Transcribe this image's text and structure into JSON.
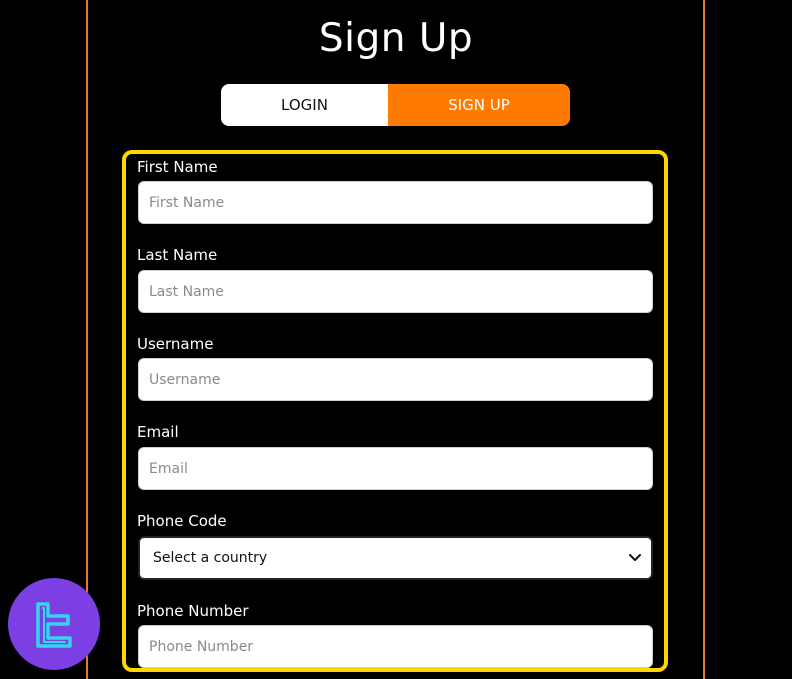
{
  "page": {
    "title": "Sign Up"
  },
  "tabs": [
    {
      "label": "LOGIN",
      "active": false
    },
    {
      "label": "SIGN UP",
      "active": true
    }
  ],
  "colors": {
    "accent": "#ff7b00",
    "highlight_border": "#ffd700",
    "panel_border": "#e07a2e",
    "logo_bg": "#7b3fe4",
    "logo_glyph": "#35d4f0"
  },
  "form": {
    "first_name": {
      "label": "First Name",
      "placeholder": "First Name",
      "value": ""
    },
    "last_name": {
      "label": "Last Name",
      "placeholder": "Last Name",
      "value": ""
    },
    "username": {
      "label": "Username",
      "placeholder": "Username",
      "value": ""
    },
    "email": {
      "label": "Email",
      "placeholder": "Email",
      "value": ""
    },
    "phone_code": {
      "label": "Phone Code",
      "selected": "Select a country"
    },
    "phone_number": {
      "label": "Phone Number",
      "placeholder": "Phone Number",
      "value": ""
    }
  },
  "icons": {
    "select_caret": "chevron-down-icon",
    "logo": "tc-logo-icon"
  }
}
